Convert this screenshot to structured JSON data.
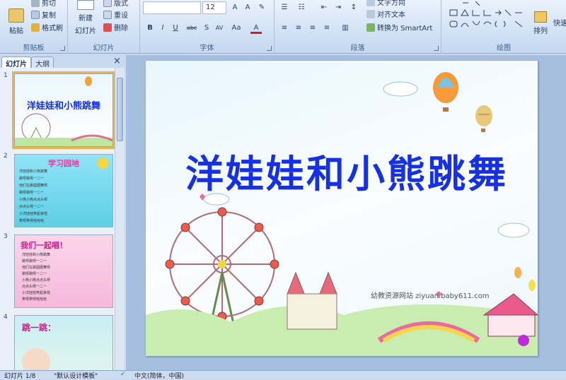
{
  "ribbon": {
    "clipboard": {
      "paste": "粘贴",
      "cut": "剪切",
      "copy": "复制",
      "format_painter": "格式刷",
      "label": "剪贴板"
    },
    "slides": {
      "new_slide": "新建",
      "new_slide_sub": "幻灯片",
      "layout": "版式",
      "reset": "重设",
      "delete": "删除",
      "label": "幻灯片"
    },
    "font": {
      "font_name": "",
      "font_size": "12",
      "label": "字体",
      "buttons": [
        "B",
        "I",
        "U",
        "abc",
        "S",
        "AV",
        "Aa",
        "A"
      ]
    },
    "paragraph": {
      "text_direction": "文字方向",
      "align_text": "对齐文本",
      "smartart": "转换为 SmartArt",
      "label": "段落"
    },
    "drawing": {
      "arrange": "排列",
      "quick_styles": "快速",
      "label": "绘图"
    }
  },
  "panel": {
    "tab_slides": "幻灯片",
    "tab_outline": "大纲",
    "close": "×",
    "thumbnails": [
      {
        "num": "1",
        "title": "洋娃娃和小熊跳舞"
      },
      {
        "num": "2",
        "title": "学习园地",
        "lines": [
          "洋娃娃和小熊跳舞",
          "跳呀跳呀一二一",
          "他们在跳圆圈舞呀",
          "跳呀跳呀一二一",
          "小熊小熊点点头呀",
          "点点头呀一二一",
          "小洋娃娃笑起来啦",
          "笑呀笑呀哈哈哈"
        ]
      },
      {
        "num": "3",
        "title": "我们一起唱！",
        "lines": [
          "洋娃娃和小熊跳舞",
          "跳呀跳呀一二一",
          "他们在跳圆圈舞呀",
          "跳呀跳呀一二一",
          "小熊小熊点点头呀",
          "点点头呀一二一",
          "小洋娃娃笑起来啦",
          "笑呀笑呀哈哈哈"
        ]
      },
      {
        "num": "4",
        "title": "跳一跳："
      }
    ]
  },
  "slide": {
    "title": "洋娃娃和小熊跳舞",
    "website": "幼教资源网站  ziyuan.baby611.com"
  },
  "status": {
    "slide_count": "幻灯片 1/8",
    "theme": "\"默认设计模板\"",
    "language": "中文(简体，中国)"
  }
}
